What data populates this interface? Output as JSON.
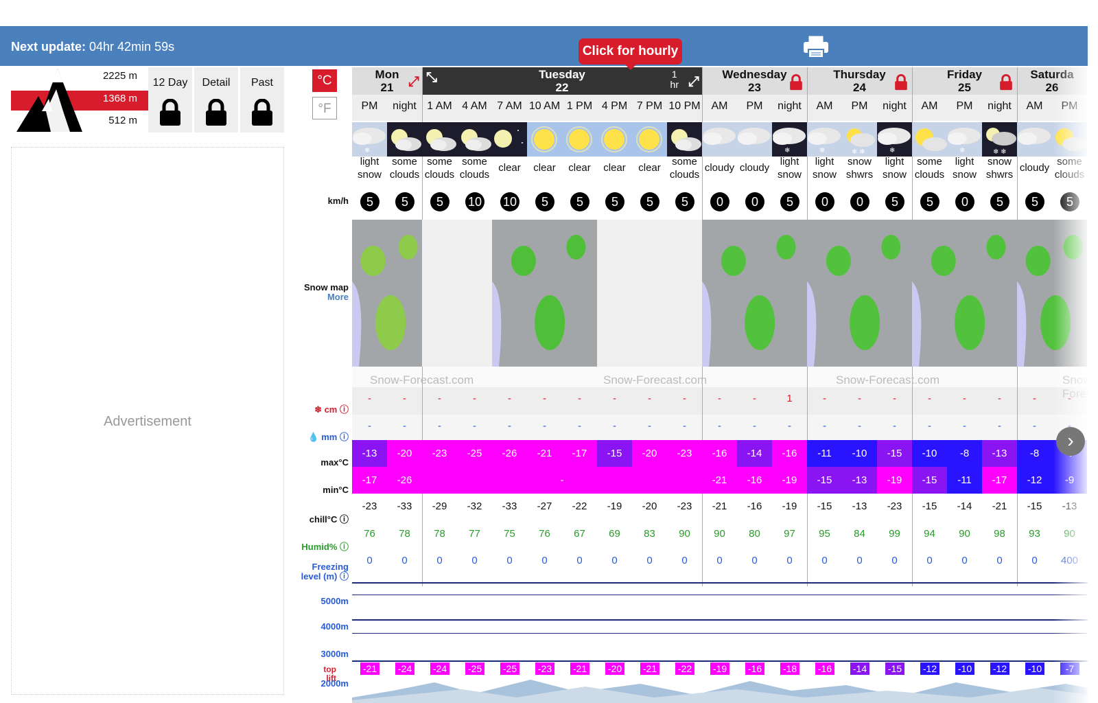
{
  "header": {
    "next_update_label": "Next update:",
    "next_update_value": " 04hr 42min 59s",
    "hourly_tooltip": "Click for hourly"
  },
  "elevations": {
    "top": "2225",
    "top_unit": "m",
    "mid": "1368",
    "mid_unit": "m",
    "bot": "512",
    "bot_unit": "m"
  },
  "tabs": [
    "12 Day",
    "Detail",
    "Past"
  ],
  "units": {
    "c": "°C",
    "f": "°F"
  },
  "labels": {
    "wind": "km/h",
    "snowmap": "Snow map",
    "more": "More",
    "cm": "cm",
    "mm": "mm",
    "maxc": "max°C",
    "minc": "min°C",
    "chill": "chill°C",
    "humid": "Humid%",
    "freezing1": "Freezing",
    "freezing2": "level (m)",
    "l5000": "5000m",
    "l4000": "4000m",
    "l3000": "3000m",
    "l2000": "2000m",
    "top": "top",
    "lift": "lift"
  },
  "advertisement": "Advertisement",
  "watermark": "Snow-Forecast.com",
  "days": [
    {
      "name": "Mon",
      "date": "21",
      "cols": 2
    },
    {
      "name": "Tuesday",
      "date": "22",
      "cols": 8,
      "extra": "1",
      "extra2": "hr"
    },
    {
      "name": "Wednesday",
      "date": "23",
      "cols": 3
    },
    {
      "name": "Thursday",
      "date": "24",
      "cols": 3
    },
    {
      "name": "Friday",
      "date": "25",
      "cols": 3
    },
    {
      "name": "Saturda",
      "date": "26",
      "cols": 2
    }
  ],
  "periods": [
    "PM",
    "night",
    "1 AM",
    "4 AM",
    "7 AM",
    "10 AM",
    "1 PM",
    "4 PM",
    "7 PM",
    "10 PM",
    "AM",
    "PM",
    "night",
    "AM",
    "PM",
    "night",
    "AM",
    "PM",
    "night",
    "AM",
    "PM"
  ],
  "conditions": [
    [
      "light",
      "snow"
    ],
    [
      "some",
      "clouds"
    ],
    [
      "some",
      "clouds"
    ],
    [
      "some",
      "clouds"
    ],
    [
      "clear",
      ""
    ],
    [
      "clear",
      ""
    ],
    [
      "clear",
      ""
    ],
    [
      "clear",
      ""
    ],
    [
      "clear",
      ""
    ],
    [
      "some",
      "clouds"
    ],
    [
      "cloudy",
      ""
    ],
    [
      "cloudy",
      ""
    ],
    [
      "light",
      "snow"
    ],
    [
      "light",
      "snow"
    ],
    [
      "snow",
      "shwrs"
    ],
    [
      "light",
      "snow"
    ],
    [
      "some",
      "clouds"
    ],
    [
      "light",
      "snow"
    ],
    [
      "snow",
      "shwrs"
    ],
    [
      "cloudy",
      ""
    ],
    [
      "some",
      "clouds"
    ]
  ],
  "sky": [
    "cloudsnow-d",
    "moon-cloud",
    "moon-cloud",
    "moon-cloud",
    "moon",
    "sun",
    "sun",
    "sun",
    "sun",
    "moon-cloud",
    "cloud-d",
    "cloud-d",
    "cloudsnow-n",
    "cloudsnow-d",
    "sunsnow",
    "cloudsnow-n",
    "sun-cloud",
    "cloudsnow-d",
    "moonsnow",
    "cloud-d",
    "sun-cloud"
  ],
  "wind": [
    "5",
    "5",
    "5",
    "10",
    "10",
    "5",
    "5",
    "5",
    "5",
    "5",
    "0",
    "0",
    "5",
    "0",
    "0",
    "5",
    "5",
    "0",
    "5",
    "5",
    "5"
  ],
  "snow_cm": [
    "-",
    "-",
    "-",
    "-",
    "-",
    "-",
    "-",
    "-",
    "-",
    "-",
    "-",
    "-",
    "1",
    "-",
    "-",
    "-",
    "-",
    "-",
    "-",
    "-",
    "-"
  ],
  "rain_mm": [
    "-",
    "-",
    "-",
    "-",
    "-",
    "-",
    "-",
    "-",
    "-",
    "-",
    "-",
    "-",
    "-",
    "-",
    "-",
    "-",
    "-",
    "-",
    "-",
    "-",
    "-"
  ],
  "max_c": [
    "-13",
    "-20",
    "-23",
    "-25",
    "-26",
    "-21",
    "-17",
    "-15",
    "-20",
    "-23",
    "-16",
    "-14",
    "-16",
    "-11",
    "-10",
    "-15",
    "-10",
    "-8",
    "-13",
    "-8",
    "-7"
  ],
  "min_c": [
    "-17",
    "-26",
    "-",
    "",
    "",
    "",
    "",
    "",
    "",
    "",
    "-21",
    "-16",
    "-19",
    "-15",
    "-13",
    "-19",
    "-15",
    "-11",
    "-17",
    "-12",
    "-9"
  ],
  "chill_c": [
    "-23",
    "-33",
    "-29",
    "-32",
    "-33",
    "-27",
    "-22",
    "-19",
    "-20",
    "-23",
    "-21",
    "-16",
    "-19",
    "-15",
    "-13",
    "-23",
    "-15",
    "-14",
    "-21",
    "-15",
    "-13"
  ],
  "humidity": [
    "76",
    "78",
    "78",
    "77",
    "75",
    "76",
    "67",
    "69",
    "83",
    "90",
    "90",
    "80",
    "97",
    "95",
    "84",
    "99",
    "94",
    "90",
    "98",
    "93",
    "90"
  ],
  "freezing": [
    "0",
    "0",
    "0",
    "0",
    "0",
    "0",
    "0",
    "0",
    "0",
    "0",
    "0",
    "0",
    "0",
    "0",
    "0",
    "0",
    "0",
    "0",
    "0",
    "0",
    "400"
  ],
  "top_lift": [
    "-21",
    "-24",
    "-24",
    "-25",
    "-25",
    "-23",
    "-21",
    "-20",
    "-21",
    "-22",
    "-19",
    "-16",
    "-18",
    "-16",
    "-14",
    "-15",
    "-12",
    "-10",
    "-12",
    "-10",
    "-7"
  ],
  "colors": {
    "magenta": "#ff00ff",
    "violet": "#8a14f2",
    "blue": "#2a14ff",
    "red": "#d71d2c",
    "topbar": "#4a81bd"
  }
}
